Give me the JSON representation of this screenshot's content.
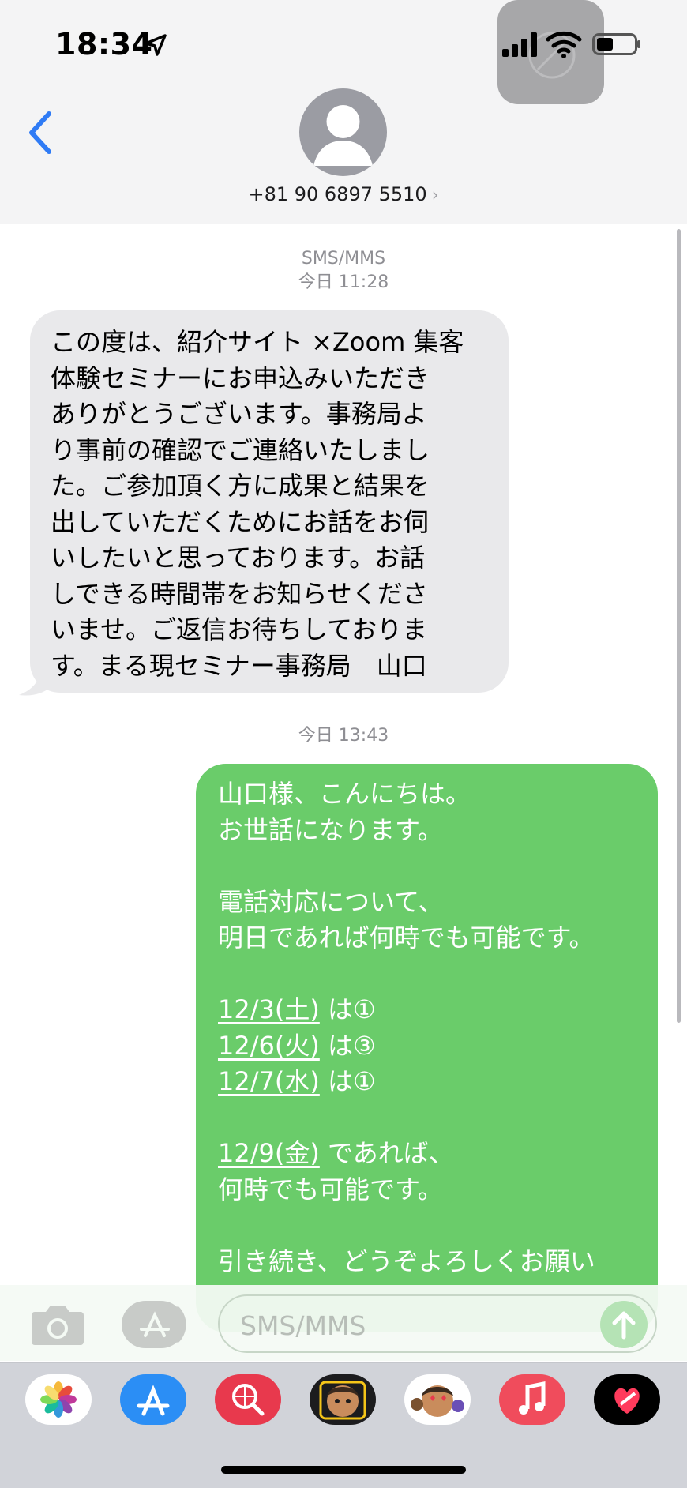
{
  "status_bar": {
    "time": "18:34"
  },
  "header": {
    "contact": "+81 90 6897 5510",
    "chevron": "›"
  },
  "thread": {
    "service_label": "SMS/MMS",
    "stamp_1": "今日 11:28",
    "incoming_message": "この度は、紹介サイト ×Zoom 集客\n体験セミナーにお申込みいただき\nありがとうございます。事務局よ\nり事前の確認でご連絡いたしまし\nた。ご参加頂く方に成果と結果を\n出していただくためにお話をお伺\nいしたいと思っております。お話\nしできる時間帯をお知らせくださ\nいませ。ご返信お待ちしておりま\nす。まる現セミナー事務局　山口",
    "stamp_2": "今日 13:43",
    "outgoing": {
      "l1": "山口様、こんにちは。",
      "l2": "お世話になります。",
      "l3": "電話対応について、",
      "l4": "明日であれば何時でも可能です。",
      "d1": "12/3(土)",
      "s1": "は①",
      "d2": "12/6(火)",
      "s2": "は③",
      "d3": "12/7(水)",
      "s3": "は①",
      "d4": "12/9(金)",
      "s4": "であれば、",
      "l5": "何時でも可能です。",
      "l6": "引き続き、どうぞよろしくお願い"
    }
  },
  "composer": {
    "placeholder": "SMS/MMS"
  },
  "tray_apps": [
    "photos-icon",
    "app-store-icon",
    "web-search-icon",
    "memoji-1-icon",
    "memoji-2-icon",
    "music-icon",
    "fitness-heart-icon"
  ],
  "colors": {
    "outgoing_bubble": "#6acc6a",
    "incoming_bubble": "#e9e9eb",
    "ios_blue": "#2f7bf5"
  }
}
